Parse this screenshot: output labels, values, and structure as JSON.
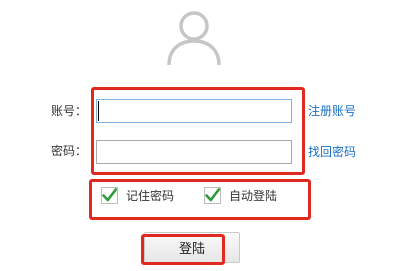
{
  "avatar": {
    "icon": "user-avatar-icon"
  },
  "username": {
    "label": "账号：",
    "value": "",
    "placeholder": "",
    "link": "注册账号"
  },
  "password": {
    "label": "密码：",
    "value": "",
    "placeholder": "",
    "link": "找回密码"
  },
  "options": {
    "remember": {
      "label": "记住密码",
      "checked": true
    },
    "auto_login": {
      "label": "自动登陆",
      "checked": true
    }
  },
  "login_button": {
    "label": "登陆"
  },
  "colors": {
    "highlight": "#e02a21",
    "link": "#1a6fc0",
    "check": "#2e9b3a"
  }
}
